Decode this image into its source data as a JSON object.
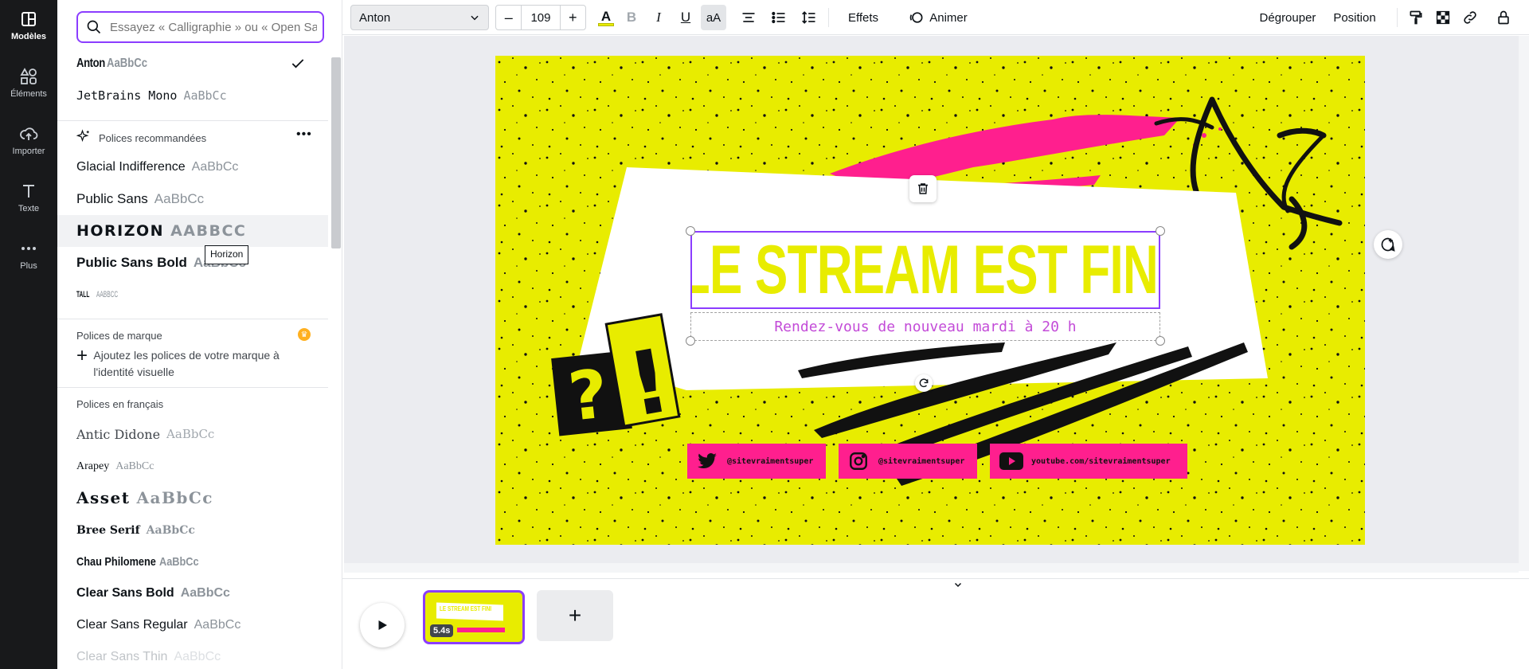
{
  "sidebar": {
    "items": [
      {
        "label": "Modèles",
        "icon": "template-icon"
      },
      {
        "label": "Éléments",
        "icon": "shapes-icon"
      },
      {
        "label": "Importer",
        "icon": "upload-cloud-icon"
      },
      {
        "label": "Texte",
        "icon": "text-icon"
      },
      {
        "label": "Plus",
        "icon": "more-icon"
      }
    ]
  },
  "font_panel": {
    "search_placeholder": "Essayez « Calligraphie » ou « Open Sa",
    "recent_fonts": [
      {
        "name": "Anton",
        "sample": "AaBbCc"
      },
      {
        "name": "JetBrains Mono",
        "sample": "AaBbCc"
      }
    ],
    "recommended_title": "Polices recommandées",
    "recommended": [
      {
        "name": "Glacial Indifference",
        "sample": "AaBbCc"
      },
      {
        "name": "Public Sans",
        "sample": "AaBbCc"
      },
      {
        "name": "HORIZON",
        "sample": "AABBCC"
      },
      {
        "name": "Public Sans Bold",
        "sample": "AaBbCc"
      },
      {
        "name": "TALL",
        "sample": "AABBCC"
      }
    ],
    "tooltip": "Horizon",
    "brand_title": "Polices de marque",
    "brand_add": "Ajoutez les polices de votre marque à l'identité visuelle",
    "french_title": "Polices en français",
    "french": [
      {
        "name": "Antic Didone",
        "sample": "AaBbCc"
      },
      {
        "name": "Arapey",
        "sample": "AaBbCc"
      },
      {
        "name": "Asset",
        "sample": "AaBbCc"
      },
      {
        "name": "Bree Serif",
        "sample": "AaBbCc"
      },
      {
        "name": "Chau Philomene",
        "sample": "AaBbCc"
      },
      {
        "name": "Clear Sans Bold",
        "sample": "AaBbCc"
      },
      {
        "name": "Clear Sans Regular",
        "sample": "AaBbCc"
      },
      {
        "name": "Clear Sans Thin",
        "sample": "AaBbCc"
      }
    ]
  },
  "toolbar": {
    "font": "Anton",
    "size": "109",
    "minus": "–",
    "plus": "+",
    "bold": "B",
    "italic": "I",
    "underline": "U",
    "case": "aA",
    "effects": "Effets",
    "animate": "Animer",
    "ungroup": "Dégrouper",
    "position": "Position"
  },
  "design": {
    "headline": "LE STREAM EST FINI",
    "subtitle": "Rendez-vous de nouveau mardi à 20 h",
    "symbols": "?!",
    "socials": [
      {
        "icon": "twitter-icon",
        "text": "@sitevraimentsuper"
      },
      {
        "icon": "instagram-icon",
        "text": "@sitevraimentsuper"
      },
      {
        "icon": "youtube-icon",
        "text": "youtube.com/sitevraimentsuper"
      }
    ],
    "colors": {
      "background": "#e8ec00",
      "pink": "#ff1f8e",
      "black": "#111111",
      "subtitle": "#c34bd8"
    }
  },
  "timeline": {
    "duration": "5.4s",
    "thumb_title": "LE STREAM EST FINI"
  }
}
